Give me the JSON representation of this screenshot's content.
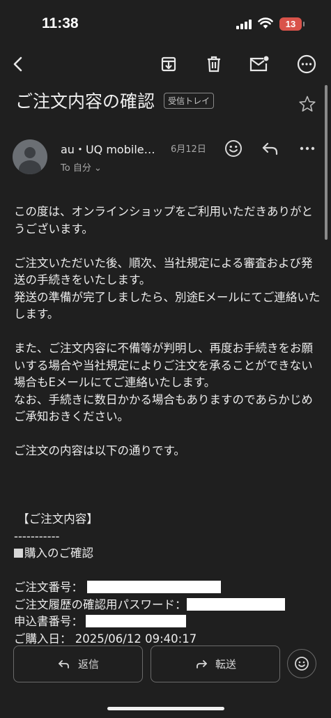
{
  "status_bar": {
    "time": "11:38",
    "battery": "13"
  },
  "email": {
    "subject": "ご注文内容の確認",
    "label": "受信トレイ",
    "sender": "au・UQ mobile…",
    "date": "6月12日",
    "to": "To 自分 ⌄"
  },
  "body": {
    "lines": [
      "この度は、オンラインショップをご利用いただきありがとうございます。",
      "",
      "ご注文いただいた後、順次、当社規定による審査および発送の手続きをいたします。",
      "発送の準備が完了しましたら、別途Eメールにてご連絡いたします。",
      "",
      "また、ご注文内容に不備等が判明し、再度お手続きをお願いする場合や当社規定によりご注文を承ることができない場合もEメールにてご連絡いたします。",
      "なお、手続きに数日かかる場合もありますのであらかじめご承知おきください。",
      "",
      "ご注文の内容は以下の通りです。"
    ],
    "order_header": " 【ご注文内容】",
    "dashes": "-----------",
    "confirm_heading": "購入のご確認",
    "order_number_label": "ご注文番号：",
    "password_label": "ご注文履歴の確認用パスワード：",
    "application_label": "申込書番号：",
    "purchase_date_label": "ご購入日：",
    "purchase_date_value": "2025/06/12 09:40:17"
  },
  "reply_bar": {
    "reply_label": "返信",
    "forward_label": "転送"
  },
  "icons": [
    "back-icon",
    "archive-icon",
    "trash-icon",
    "mark-unread-icon",
    "more-icon",
    "star-icon",
    "emoji-icon",
    "reply-icon",
    "more-horizontal-icon"
  ]
}
